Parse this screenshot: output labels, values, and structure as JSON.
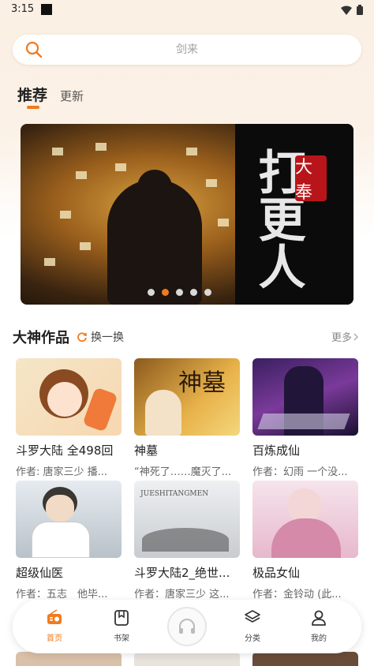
{
  "status_bar": {
    "time": "3:15"
  },
  "search": {
    "placeholder": "剑来"
  },
  "tabs": [
    {
      "label": "推荐",
      "active": true
    },
    {
      "label": "更新",
      "active": false
    }
  ],
  "banner": {
    "title": "大奉",
    "calligraphy": "打更人",
    "dots": 5,
    "active_dot": 1
  },
  "section": {
    "title": "大神作品",
    "refresh_label": "换一换",
    "more_label": "更多"
  },
  "books": [
    {
      "title": "斗罗大陆 全498回",
      "desc": "作者: 唐家三少 播..."
    },
    {
      "title": "神墓",
      "desc": "“神死了……魔灭了..."
    },
    {
      "title": "百炼成仙",
      "desc": "作者：幻雨 一个没..."
    },
    {
      "title": "超级仙医",
      "desc": "作者：五志　他毕..."
    },
    {
      "title": "斗罗大陆2_绝世...",
      "desc": "作者：唐家三少 这..."
    },
    {
      "title": "极品女仙",
      "desc": "作者：金铃动 (此..."
    }
  ],
  "covers": {
    "cover_2_text": "神墓",
    "cover_5_text": "JUESHITANGMEN"
  },
  "bottom_nav": [
    {
      "label": "首页",
      "icon": "radio-icon",
      "active": true
    },
    {
      "label": "书架",
      "icon": "bookmark-icon",
      "active": false
    },
    {
      "label": "",
      "icon": "headphones-icon",
      "active": false
    },
    {
      "label": "分类",
      "icon": "layers-icon",
      "active": false
    },
    {
      "label": "我的",
      "icon": "user-icon",
      "active": false
    }
  ],
  "colors": {
    "accent": "#f07a1e",
    "background_top": "#fbf0e4"
  }
}
